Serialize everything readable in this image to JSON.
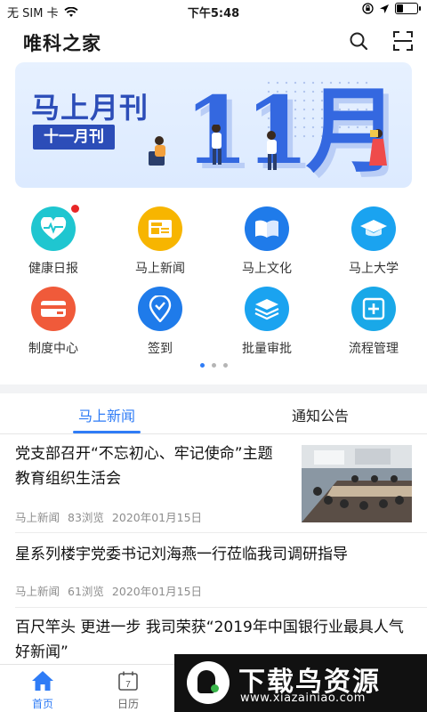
{
  "status_bar": {
    "carrier": "无 SIM 卡",
    "time": "下午5:48",
    "battery_level": 0.3
  },
  "header": {
    "title": "唯科之家",
    "icons": [
      "search-icon",
      "scan-icon"
    ]
  },
  "banner": {
    "title": "马上月刊",
    "subtitle": "十一月刊",
    "big_text": "11月",
    "slide_count": 4,
    "active_slide": 0
  },
  "grid": {
    "items": [
      {
        "label": "健康日报",
        "icon": "heart-pulse-icon",
        "color": "#1fc6d0",
        "badge": true
      },
      {
        "label": "马上新闻",
        "icon": "news-icon",
        "color": "#f7b500",
        "badge": false
      },
      {
        "label": "马上文化",
        "icon": "book-icon",
        "color": "#1f7bea",
        "badge": false
      },
      {
        "label": "马上大学",
        "icon": "graduation-cap-icon",
        "color": "#1aa3f0",
        "badge": false
      },
      {
        "label": "制度中心",
        "icon": "card-icon",
        "color": "#f05a3a",
        "badge": false
      },
      {
        "label": "签到",
        "icon": "location-check-icon",
        "color": "#1f7bea",
        "badge": false
      },
      {
        "label": "批量审批",
        "icon": "layers-icon",
        "color": "#1aa3f0",
        "badge": false
      },
      {
        "label": "流程管理",
        "icon": "plus-icon",
        "color": "#19a8e8",
        "badge": false
      }
    ],
    "page_count": 3,
    "active_page": 0
  },
  "tabs": {
    "items": [
      "马上新闻",
      "通知公告"
    ],
    "active": 0
  },
  "news": [
    {
      "title": "党支部召开“不忘初心、牢记使命”主题教育组织生活会",
      "source": "马上新闻",
      "views": "83浏览",
      "date": "2020年01月15日",
      "has_image": true
    },
    {
      "title": "星系列楼宇党委书记刘海燕一行莅临我司调研指导",
      "source": "马上新闻",
      "views": "61浏览",
      "date": "2020年01月15日",
      "has_image": false
    },
    {
      "title": "百尺竿头 更进一步 我司荣获“2019年中国银行业最具人气好新闻”",
      "source": "",
      "views": "",
      "date": "",
      "has_image": false
    }
  ],
  "tabbar": {
    "items": [
      {
        "label": "首页",
        "icon": "home-icon"
      },
      {
        "label": "日历",
        "icon": "calendar-icon",
        "day": "7"
      }
    ],
    "active": 0
  },
  "watermark": {
    "cn": "下载鸟资源",
    "en": "www.xiazainiao.com"
  },
  "colors": {
    "accent": "#2f7cf6",
    "badge": "#e82626",
    "banner_blue": "#2c4db8"
  }
}
